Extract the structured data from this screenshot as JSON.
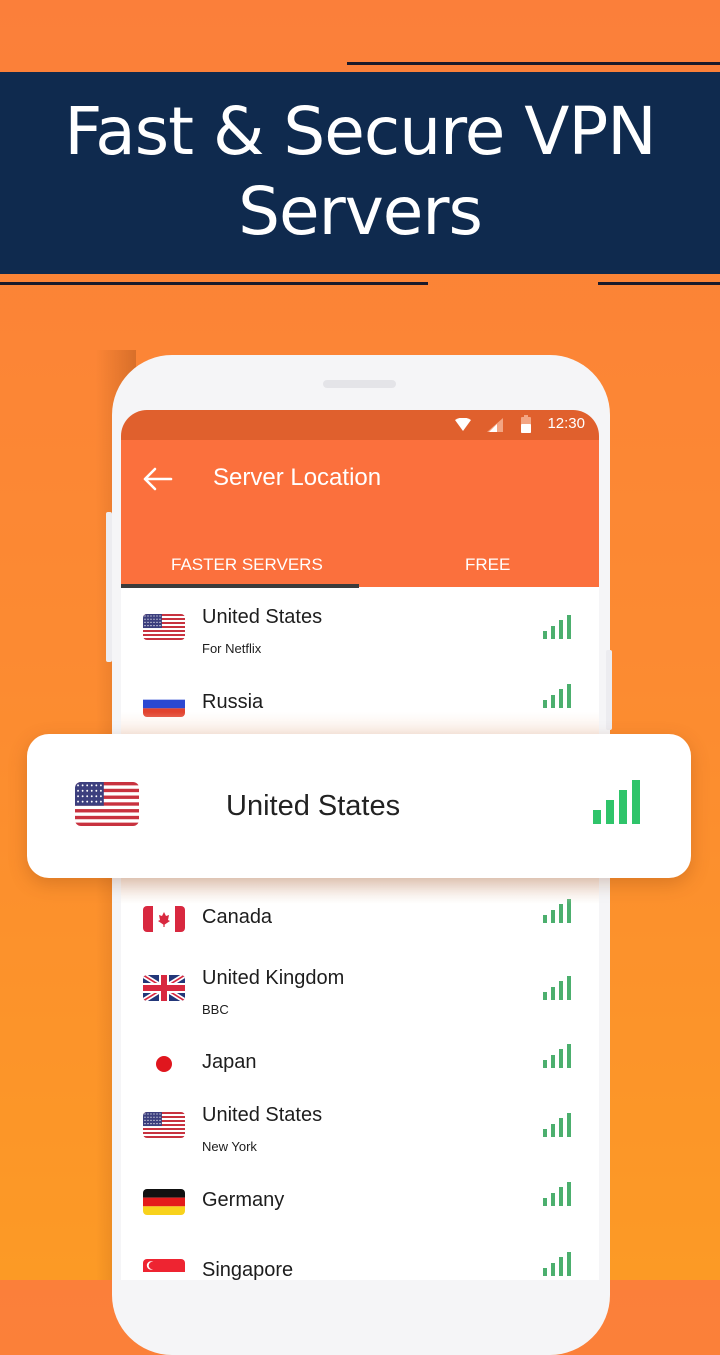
{
  "promo": {
    "headline_line1": "Fast & Secure VPN",
    "headline_line2": "Servers"
  },
  "status_bar": {
    "time": "12:30",
    "icons": [
      "wifi-icon",
      "cell-signal-icon",
      "battery-icon"
    ]
  },
  "app_bar": {
    "back_icon": "arrow-left-icon",
    "title": "Server Location"
  },
  "tabs": [
    {
      "label": "FASTER SERVERS",
      "selected": true
    },
    {
      "label": "FREE",
      "selected": false
    }
  ],
  "colors": {
    "accent": "#fb703d",
    "status_bar": "#e0602d",
    "banner": "#0f2a4e",
    "signal": "#4caf6e"
  },
  "servers": [
    {
      "country": "United States",
      "subtitle": "For Netflix",
      "flag": "us-flag-icon",
      "signal_bars": 4
    },
    {
      "country": "Russia",
      "subtitle": "",
      "flag": "russia-flag-icon",
      "signal_bars": 4
    },
    {
      "country": "Canada",
      "subtitle": "",
      "flag": "canada-flag-icon",
      "signal_bars": 4
    },
    {
      "country": "United Kingdom",
      "subtitle": "BBC",
      "flag": "uk-flag-icon",
      "signal_bars": 4
    },
    {
      "country": "Japan",
      "subtitle": "",
      "flag": "japan-flag-icon",
      "signal_bars": 4
    },
    {
      "country": "United States",
      "subtitle": "New York",
      "flag": "us-flag-icon",
      "signal_bars": 4
    },
    {
      "country": "Germany",
      "subtitle": "",
      "flag": "germany-flag-icon",
      "signal_bars": 4
    },
    {
      "country": "Singapore",
      "subtitle": "",
      "flag": "singapore-flag-icon",
      "signal_bars": 4
    }
  ],
  "highlight_card": {
    "country": "United States",
    "flag": "us-flag-icon",
    "signal_bars": 4
  }
}
